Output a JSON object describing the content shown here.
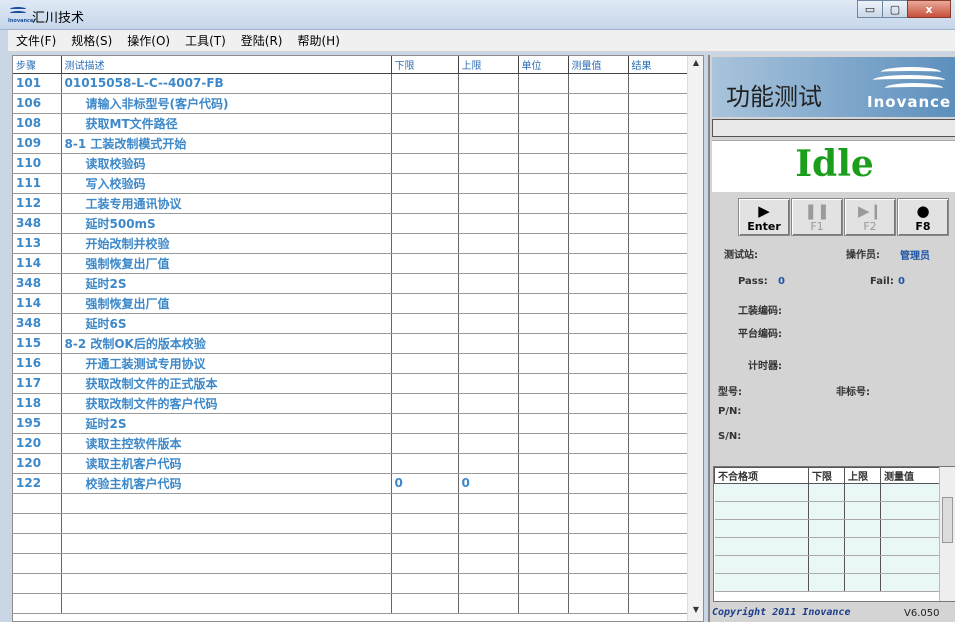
{
  "window": {
    "title": "汇川技术",
    "logo_text": "Inovance",
    "minimize_glyph": "▭",
    "maximize_glyph": "▢",
    "close_glyph": "x"
  },
  "menu": [
    "文件(F)",
    "规格(S)",
    "操作(O)",
    "工具(T)",
    "登陆(R)",
    "帮助(H)"
  ],
  "table": {
    "columns": [
      "步骤",
      "测试描述",
      "下限",
      "上限",
      "单位",
      "测量值",
      "结果"
    ],
    "rows": [
      {
        "step": "101",
        "desc": "01015058-L-C--4007-FB",
        "indent": false,
        "lower": "",
        "upper": ""
      },
      {
        "step": "106",
        "desc": "请输入非标型号(客户代码)",
        "indent": true,
        "lower": "",
        "upper": ""
      },
      {
        "step": "108",
        "desc": "获取MT文件路径",
        "indent": true,
        "lower": "",
        "upper": ""
      },
      {
        "step": "109",
        "desc": "8-1 工装改制模式开始",
        "indent": false,
        "lower": "",
        "upper": ""
      },
      {
        "step": "110",
        "desc": "读取校验码",
        "indent": true,
        "lower": "",
        "upper": ""
      },
      {
        "step": "111",
        "desc": "写入校验码",
        "indent": true,
        "lower": "",
        "upper": ""
      },
      {
        "step": "112",
        "desc": "工装专用通讯协议",
        "indent": true,
        "lower": "",
        "upper": ""
      },
      {
        "step": "348",
        "desc": "延时500mS",
        "indent": true,
        "lower": "",
        "upper": ""
      },
      {
        "step": "113",
        "desc": "开始改制并校验",
        "indent": true,
        "lower": "",
        "upper": ""
      },
      {
        "step": "114",
        "desc": "强制恢复出厂值",
        "indent": true,
        "lower": "",
        "upper": ""
      },
      {
        "step": "348",
        "desc": "延时2S",
        "indent": true,
        "lower": "",
        "upper": ""
      },
      {
        "step": "114",
        "desc": "强制恢复出厂值",
        "indent": true,
        "lower": "",
        "upper": ""
      },
      {
        "step": "348",
        "desc": "延时6S",
        "indent": true,
        "lower": "",
        "upper": ""
      },
      {
        "step": "115",
        "desc": "8-2 改制OK后的版本校验",
        "indent": false,
        "lower": "",
        "upper": ""
      },
      {
        "step": "116",
        "desc": "开通工装测试专用协议",
        "indent": true,
        "lower": "",
        "upper": ""
      },
      {
        "step": "117",
        "desc": "获取改制文件的正式版本",
        "indent": true,
        "lower": "",
        "upper": ""
      },
      {
        "step": "118",
        "desc": "获取改制文件的客户代码",
        "indent": true,
        "lower": "",
        "upper": ""
      },
      {
        "step": "195",
        "desc": "延时2S",
        "indent": true,
        "lower": "",
        "upper": ""
      },
      {
        "step": "120",
        "desc": "读取主控软件版本",
        "indent": true,
        "lower": "",
        "upper": ""
      },
      {
        "step": "120",
        "desc": "读取主机客户代码",
        "indent": true,
        "lower": "",
        "upper": ""
      },
      {
        "step": "122",
        "desc": "校验主机客户代码",
        "indent": true,
        "lower": "0",
        "upper": "0"
      }
    ]
  },
  "panel": {
    "title": "功能测试",
    "logo_text": "Inovance",
    "status": "Idle",
    "buttons": [
      {
        "glyph": "▶",
        "label": "Enter",
        "enabled": true
      },
      {
        "glyph": "❚❚",
        "label": "F1",
        "enabled": false
      },
      {
        "glyph": "▶❙",
        "label": "F2",
        "enabled": false
      },
      {
        "glyph": "●",
        "label": "F8",
        "enabled": true
      }
    ],
    "station_label": "测试站:",
    "operator_label": "操作员:",
    "operator_value": "管理员",
    "pass_label": "Pass:",
    "pass_value": "0",
    "fail_label": "Fail:",
    "fail_value": "0",
    "fixture_label": "工装编码:",
    "platform_label": "平台编码:",
    "timer_label": "计时器:",
    "model_label": "型号:",
    "nonstd_label": "非标号:",
    "pn_label": "P/N:",
    "sn_label": "S/N:",
    "fail_table_columns": [
      "不合格项",
      "下限",
      "上限",
      "测量值"
    ],
    "copyright": "Copyright 2011 Inovance",
    "version": "V6.050"
  }
}
